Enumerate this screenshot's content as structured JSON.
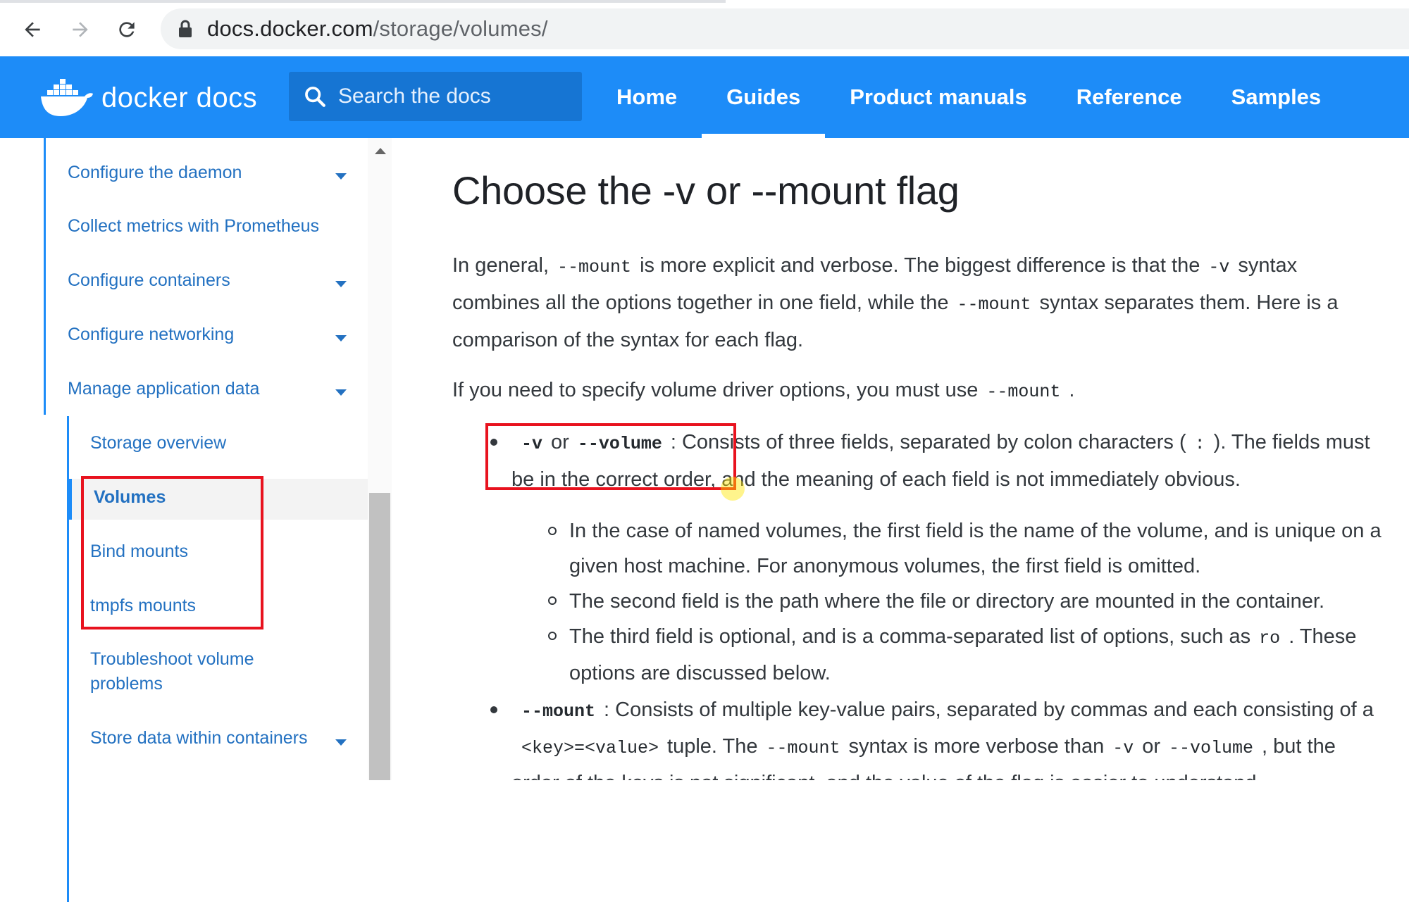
{
  "browser": {
    "url_domain": "docs.docker.com",
    "url_path": "/storage/volumes/"
  },
  "header": {
    "logo_text": "docker docs",
    "search_placeholder": "Search the docs",
    "nav": [
      {
        "label": "Home",
        "active": false
      },
      {
        "label": "Guides",
        "active": true
      },
      {
        "label": "Product manuals",
        "active": false
      },
      {
        "label": "Reference",
        "active": false
      },
      {
        "label": "Samples",
        "active": false
      }
    ]
  },
  "sidebar": {
    "items": [
      {
        "label": "Configure the daemon",
        "expandable": true
      },
      {
        "label": "Collect metrics with Prometheus",
        "expandable": false
      },
      {
        "label": "Configure containers",
        "expandable": true
      },
      {
        "label": "Configure networking",
        "expandable": true
      },
      {
        "label": "Manage application data",
        "expandable": true
      }
    ],
    "subitems": [
      {
        "label": "Storage overview"
      },
      {
        "label": "Volumes",
        "active": true
      },
      {
        "label": "Bind mounts"
      },
      {
        "label": "tmpfs mounts"
      },
      {
        "label": "Troubleshoot volume problems"
      },
      {
        "label": "Store data within containers",
        "expandable": true
      }
    ]
  },
  "content": {
    "title": "Choose the -v or --mount flag",
    "p1": {
      "t1": "In general,",
      "c1": "--mount",
      "t2": "is more explicit and verbose. The biggest difference is that the",
      "c2": "-v",
      "t3": "syntax",
      "t4": "combines all the options together in one field, while the",
      "c3": "--mount",
      "t5": "syntax separates them. Here is a",
      "t6": "comparison of the syntax for each flag."
    },
    "p2": {
      "t1": "If you need to specify volume driver options, you must use",
      "c1": "--mount",
      "t2": "."
    },
    "bullet1": {
      "c1": "-v",
      "t1": "or",
      "c2": "--volume",
      "t2": ": Consists of three fields, separated by colon characters (",
      "c3": ":",
      "t3": "). The fields must",
      "t4": "be in the correct order, and the meaning of each field is not immediately obvious."
    },
    "sub1": {
      "l1": "In the case of named volumes, the first field is the name of the volume, and is unique on a",
      "l2": "given host machine. For anonymous volumes, the first field is omitted."
    },
    "sub2": "The second field is the path where the file or directory are mounted in the container.",
    "sub3": {
      "t1": "The third field is optional, and is a comma-separated list of options, such as",
      "c1": "ro",
      "t2": ". These",
      "l2": "options are discussed below."
    },
    "bullet2": {
      "c1": "--mount",
      "t1": ": Consists of multiple key-value pairs, separated by commas and each consisting of a",
      "c2": "<key>=<value>",
      "t2": "tuple. The",
      "c3": "--mount",
      "t3": "syntax is more verbose than",
      "c4": "-v",
      "t4": "or",
      "c5": "--volume",
      "t5": ", but the",
      "t6": "order of the keys is not significant, and the value of the flag is easier to understand."
    }
  },
  "colors": {
    "brand_blue": "#1d8cf8",
    "link_blue": "#2371c1",
    "annotation_red": "#e8121e"
  }
}
